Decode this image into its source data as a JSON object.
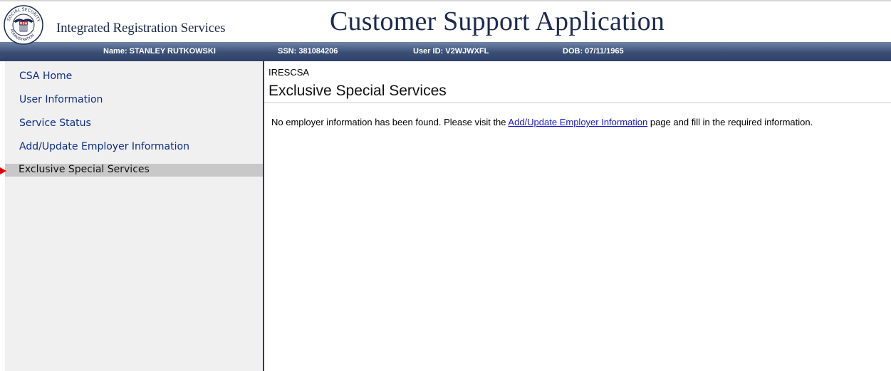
{
  "header": {
    "brand": "Integrated Registration Services",
    "app_title": "Customer Support Application",
    "logo_icon": "social-security-administration-seal-icon"
  },
  "infobar": {
    "name": "Name: STANLEY RUTKOWSKI",
    "ssn": "SSN: 381084206",
    "user_id": "User ID: V2WJWXFL",
    "dob": "DOB: 07/11/1965"
  },
  "sidebar": {
    "items": [
      {
        "label": "CSA Home",
        "active": false
      },
      {
        "label": "User Information",
        "active": false
      },
      {
        "label": "Service Status",
        "active": false
      },
      {
        "label": "Add/Update Employer Information",
        "active": false
      },
      {
        "label": "Exclusive Special Services",
        "active": true
      }
    ],
    "active_marker_icon": "red-arrow-right-icon"
  },
  "main": {
    "module_code": "IRESCSA",
    "title": "Exclusive Special Services",
    "message_before": "No employer information has been found. Please visit the ",
    "message_link": "Add/Update Employer Information",
    "message_after": " page and fill in the required information."
  },
  "colors": {
    "infobar": "#3b4f76",
    "nav_link": "#0b2e8b",
    "active_item": "#c8c8c8",
    "marker": "#e30000",
    "link": "#1717d8"
  }
}
